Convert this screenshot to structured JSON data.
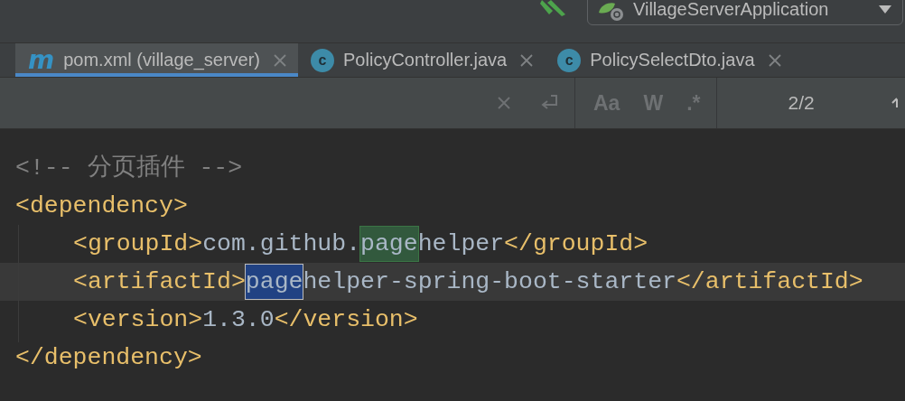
{
  "toolbar": {
    "run_configuration": "VillageServerApplication"
  },
  "tabs": [
    {
      "icon": "m",
      "kind": "maven",
      "label": "pom.xml (village_server)",
      "selected": true
    },
    {
      "icon": "c",
      "kind": "class",
      "label": "PolicyController.java",
      "selected": false
    },
    {
      "icon": "c",
      "kind": "class",
      "label": "PolicySelectDto.java",
      "selected": false
    }
  ],
  "search": {
    "options": [
      {
        "label": "Aa",
        "on": false
      },
      {
        "label": "W",
        "on": false
      },
      {
        "label": ".*",
        "on": false
      }
    ],
    "count": "2/2"
  },
  "code_lines": [
    {
      "current": false,
      "indented": false,
      "tokens": [
        {
          "kind": "comment",
          "text": "<!-- 分页插件 -->"
        }
      ]
    },
    {
      "current": false,
      "indented": false,
      "tokens": [
        {
          "kind": "tag",
          "text": "<dependency>"
        }
      ]
    },
    {
      "current": false,
      "indented": true,
      "tokens": [
        {
          "kind": "tag",
          "text": "<groupId>"
        },
        {
          "kind": "text",
          "text": "com.github."
        },
        {
          "kind": "match",
          "text": "page"
        },
        {
          "kind": "text",
          "text": "helper"
        },
        {
          "kind": "tag",
          "text": "</groupId>"
        }
      ]
    },
    {
      "current": true,
      "indented": true,
      "tokens": [
        {
          "kind": "tag",
          "text": "<artifactId>"
        },
        {
          "kind": "current_match",
          "text": "page"
        },
        {
          "kind": "text",
          "text": "helper-spring-boot-starter"
        },
        {
          "kind": "tag",
          "text": "</artifactId>"
        }
      ]
    },
    {
      "current": false,
      "indented": true,
      "tokens": [
        {
          "kind": "tag",
          "text": "<version>"
        },
        {
          "kind": "text",
          "text": "1.3.0"
        },
        {
          "kind": "tag",
          "text": "</version>"
        }
      ]
    },
    {
      "current": false,
      "indented": false,
      "tokens": [
        {
          "kind": "tag",
          "text": "</dependency>"
        }
      ]
    }
  ]
}
